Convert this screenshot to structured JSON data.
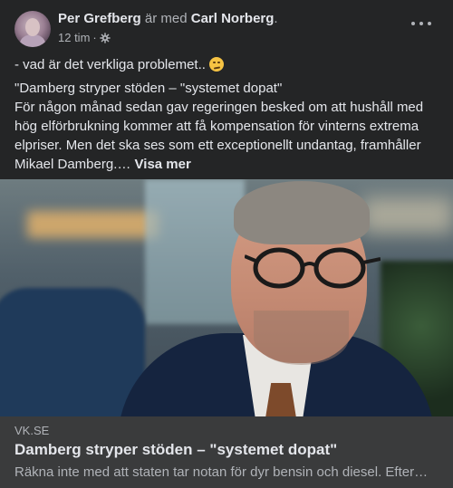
{
  "post": {
    "author": "Per Grefberg",
    "with_text": "är med",
    "tagged": "Carl Norberg",
    "tagged_suffix": ".",
    "time": "12 tim",
    "time_separator": "·",
    "privacy_icon": "gear-icon",
    "more_icon": "more-horizontal-icon",
    "caption": "- vad är det verkliga problemet..",
    "caption_emoji": "smirk-emoji",
    "quote_title": "\"Damberg stryper stöden – \"systemet dopat\"",
    "quote_body": "För någon månad sedan gav regeringen besked om att hushåll med hög elförbrukning kommer att få kompensation för vinterns extrema elpriser. Men det ska ses som ett exceptionellt undantag, framhåller Mikael Damberg.…",
    "see_more": "Visa mer"
  },
  "link": {
    "domain": "VK.SE",
    "title": "Damberg stryper stöden – \"systemet dopat\"",
    "description": "Räkna inte med att staten tar notan för dyr bensin och diesel. Efter…"
  },
  "colors": {
    "background": "#242526",
    "link_bar": "#3a3b3c",
    "text_primary": "#e4e6eb",
    "text_secondary": "#b0b3b8"
  }
}
